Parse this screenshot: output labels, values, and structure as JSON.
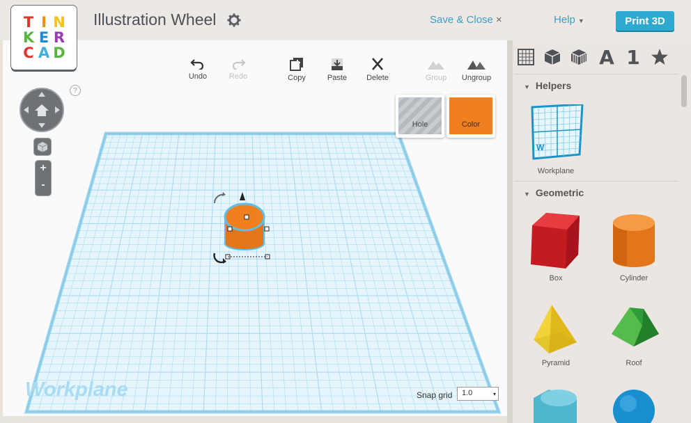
{
  "logo": {
    "letters": [
      "T",
      "I",
      "N",
      "K",
      "E",
      "R",
      "C",
      "A",
      "D"
    ],
    "colors": [
      "#e5342a",
      "#f28d1c",
      "#f4c221",
      "#58b640",
      "#1c8ad6",
      "#9b3bb3",
      "#e5342a",
      "#3fb0e0",
      "#58b640"
    ]
  },
  "header": {
    "title": "Illustration Wheel",
    "gear_icon": "gear-icon",
    "save_close": "Save & Close",
    "close_x": "×",
    "help": "Help",
    "help_caret": "▼",
    "print": "Print 3D"
  },
  "toolbar": {
    "undo": "Undo",
    "redo": "Redo",
    "copy": "Copy",
    "paste": "Paste",
    "delete": "Delete",
    "group": "Group",
    "ungroup": "Ungroup"
  },
  "swatches": {
    "hole": "Hole",
    "color": "Color",
    "color_hex": "#f07f1e"
  },
  "canvas": {
    "help_q": "?",
    "zoom_in": "+",
    "zoom_out": "-",
    "workplane_label": "Workplane",
    "snap_label": "Snap grid",
    "snap_value": "1.0",
    "snap_arrow": "▾"
  },
  "sidebar": {
    "tabs": [
      "grid-icon",
      "cube-icon",
      "striped-cube-icon",
      "A",
      "1",
      "star-icon"
    ],
    "helpers_title": "Helpers",
    "geometric_title": "Geometric",
    "helpers": [
      {
        "label": "Workplane"
      }
    ],
    "geometric": [
      {
        "label": "Box"
      },
      {
        "label": "Cylinder"
      },
      {
        "label": "Pyramid"
      },
      {
        "label": "Roof"
      }
    ],
    "section_arrow": "▼"
  },
  "colors": {
    "accent": "#3a9fc9",
    "print": "#2ea9cf",
    "grid": "#8fd0ea"
  }
}
